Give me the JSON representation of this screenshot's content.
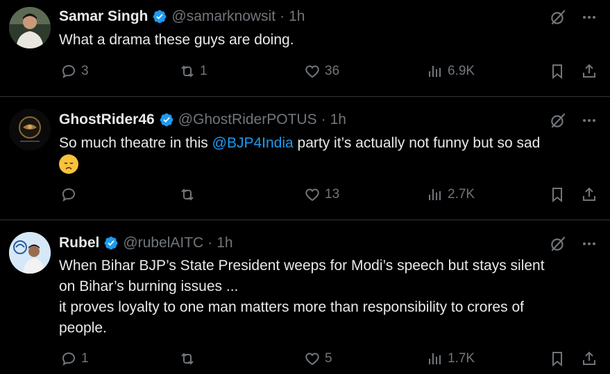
{
  "tweets": [
    {
      "name": "Samar Singh",
      "handle": "@samarknowsit",
      "dot": "·",
      "time": "1h",
      "text": "What a drama these guys are doing.",
      "replies": "3",
      "retweets": "1",
      "likes": "36",
      "views": "6.9K"
    },
    {
      "name": "GhostRider46",
      "handle": "@GhostRiderPOTUS",
      "dot": "·",
      "time": "1h",
      "text_before": "So much theatre in this ",
      "mention": "@BJP4India",
      "text_after": " party it’s actually not funny but so sad",
      "emoji": "disappointed-face",
      "replies": "",
      "retweets": "",
      "likes": "13",
      "views": "2.7K"
    },
    {
      "name": "Rubel",
      "handle": "@rubelAITC",
      "dot": "·",
      "time": "1h",
      "line1": "When Bihar BJP’s State President weeps for Modi’s speech but stays silent",
      "line2": "on Bihar’s burning issues ...",
      "line3": "it proves loyalty to one man matters more than responsibility to crores of",
      "line4": "people.",
      "replies": "1",
      "retweets": "",
      "likes": "5",
      "views": "1.7K"
    }
  ],
  "colors": {
    "accent": "#1d9bf0",
    "muted": "#71767b",
    "text": "#e7e9ea",
    "divider": "#2f3336",
    "background": "#000000"
  }
}
